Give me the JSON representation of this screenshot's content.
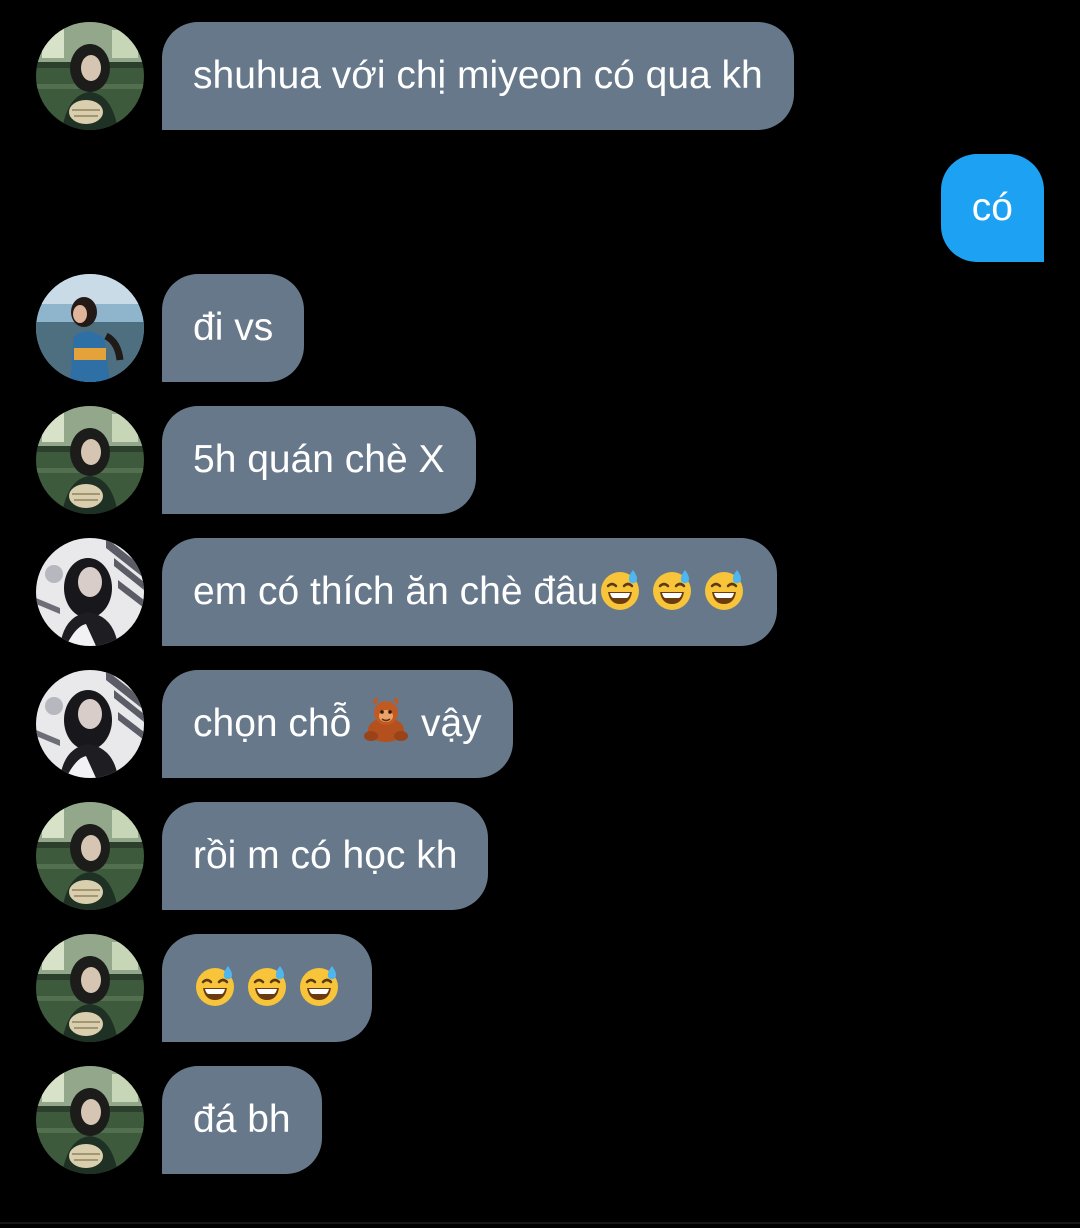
{
  "colors": {
    "background": "#000000",
    "received_bubble": "#66788a",
    "sent_bubble": "#1da1f2",
    "text": "#ffffff"
  },
  "messages": [
    {
      "side": "received",
      "avatar": "avatar-green-room-girl",
      "text": "shuhua với chị miyeon có qua kh"
    },
    {
      "side": "sent",
      "text": "có"
    },
    {
      "side": "received",
      "avatar": "avatar-beach-girl",
      "text": "đi vs"
    },
    {
      "side": "received",
      "avatar": "avatar-green-room-girl",
      "text": "5h quán chè X"
    },
    {
      "side": "received",
      "avatar": "avatar-bw-girl",
      "text_before": "em có thích ăn chè đâu",
      "emojis": [
        "sweat-smile-emoji",
        "sweat-smile-emoji",
        "sweat-smile-emoji"
      ]
    },
    {
      "side": "received",
      "avatar": "avatar-bw-girl",
      "text_before": "chọn chỗ ",
      "emoji": "orangutan-emoji",
      "text_after": " vậy"
    },
    {
      "side": "received",
      "avatar": "avatar-green-room-girl",
      "text": "rồi m có học kh"
    },
    {
      "side": "received",
      "avatar": "avatar-green-room-girl",
      "emojis": [
        "sweat-smile-emoji",
        "sweat-smile-emoji",
        "sweat-smile-emoji"
      ]
    },
    {
      "side": "received",
      "avatar": "avatar-green-room-girl",
      "text": "đá bh"
    }
  ]
}
